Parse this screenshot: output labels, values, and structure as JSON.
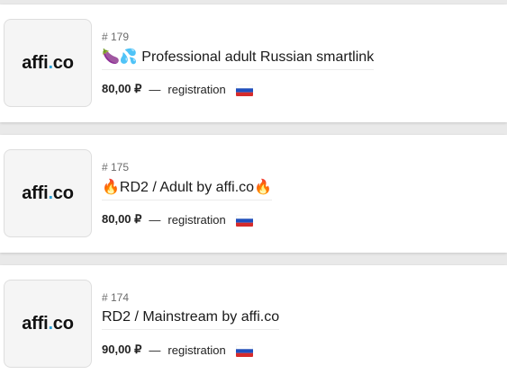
{
  "offers": [
    {
      "logo_prefix": "affi",
      "logo_dot": ".",
      "logo_suffix": "co",
      "id": "# 179",
      "title_emoji": "🍆💦",
      "title": "Professional adult Russian smartlink",
      "price": "80,00 ₽",
      "dash": "—",
      "model": "registration",
      "flag_icon": "russia-flag-icon"
    },
    {
      "logo_prefix": "affi",
      "logo_dot": ".",
      "logo_suffix": "co",
      "id": "# 175",
      "title_emoji_left": "🔥",
      "title": "RD2 / Adult by affi.co",
      "title_emoji_right": "🔥",
      "price": "80,00 ₽",
      "dash": "—",
      "model": "registration",
      "flag_icon": "russia-flag-icon"
    },
    {
      "logo_prefix": "affi",
      "logo_dot": ".",
      "logo_suffix": "co",
      "id": "# 174",
      "title": "RD2 / Mainstream by affi.co",
      "price": "90,00 ₽",
      "dash": "—",
      "model": "registration",
      "flag_icon": "russia-flag-icon"
    }
  ],
  "colors": {
    "background": "#e9e9e9",
    "card": "#ffffff",
    "logo_dot": "#2aa0d8",
    "flag_white": "#ffffff",
    "flag_blue": "#1f4fbf",
    "flag_red": "#d62b2b"
  }
}
